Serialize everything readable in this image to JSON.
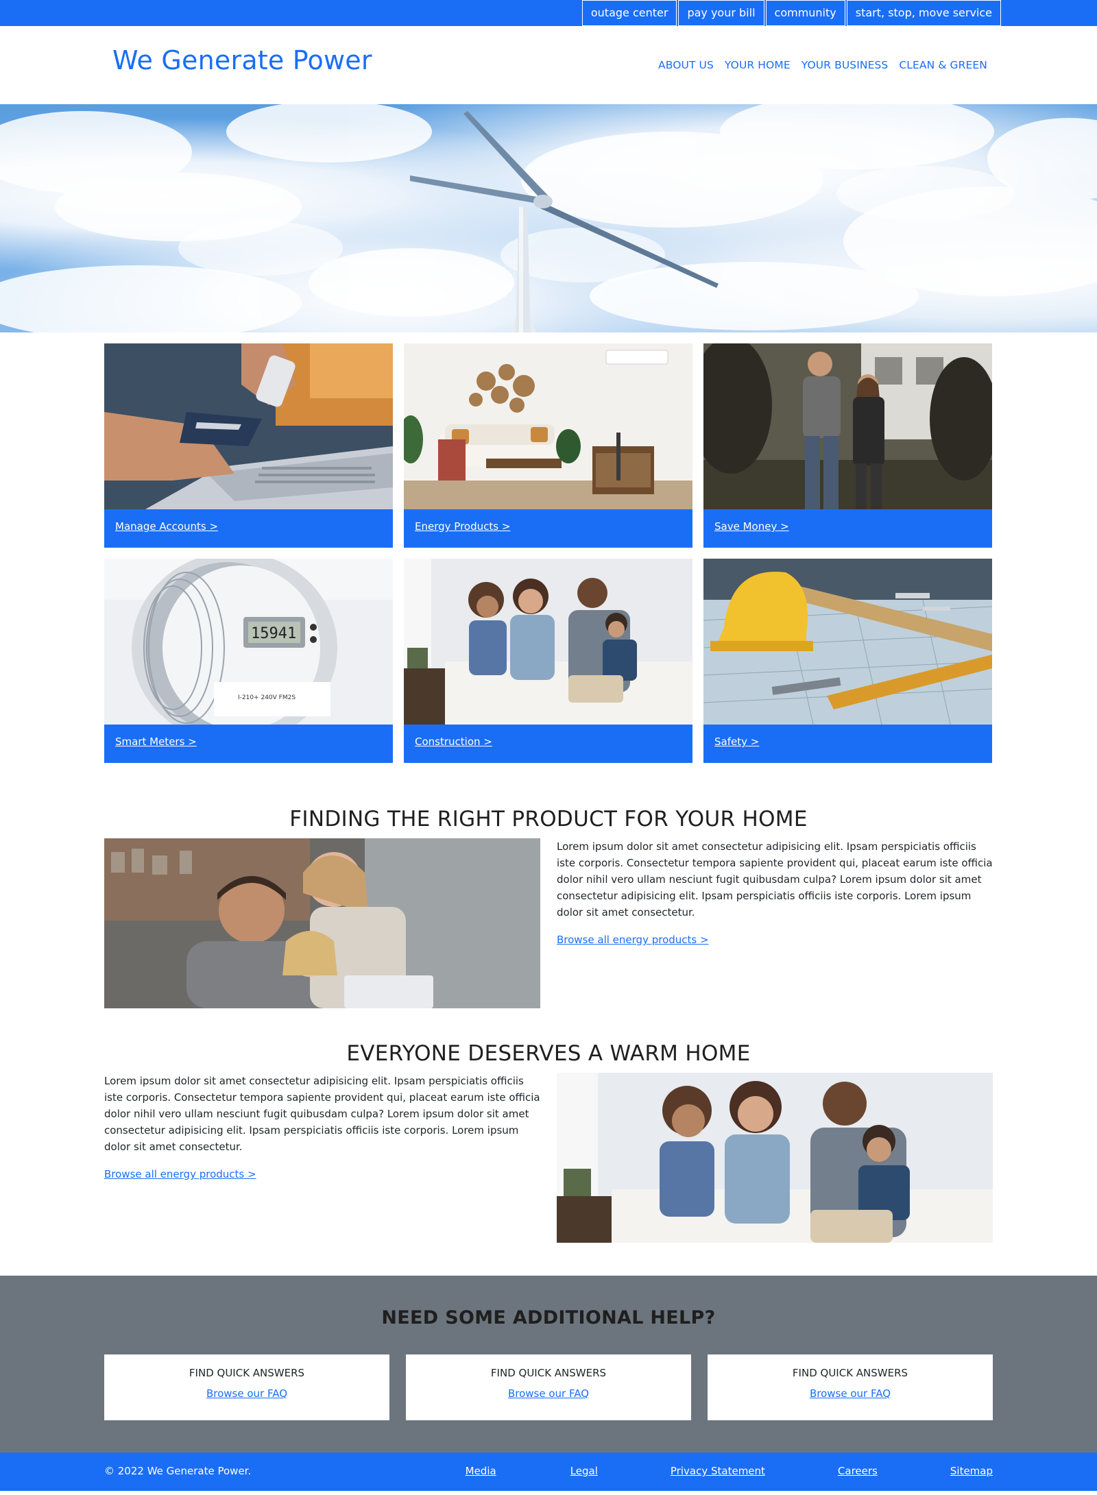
{
  "utility_nav": [
    {
      "label": "outage center"
    },
    {
      "label": "pay your bill"
    },
    {
      "label": "community"
    },
    {
      "label": "start, stop, move service"
    }
  ],
  "header": {
    "brand": "We Generate Power",
    "nav": [
      {
        "label": "ABOUT US"
      },
      {
        "label": "YOUR HOME"
      },
      {
        "label": "YOUR BUSINESS"
      },
      {
        "label": "CLEAN & GREEN"
      }
    ]
  },
  "tiles": [
    {
      "label": "Manage Accounts >",
      "image": "laptop-credit-card"
    },
    {
      "label": "Energy Products >",
      "image": "living-room"
    },
    {
      "label": "Save Money >",
      "image": "couple-outside-house"
    },
    {
      "label": "Smart Meters >",
      "image": "electric-meter"
    },
    {
      "label": "Construction >",
      "image": "family-on-couch"
    },
    {
      "label": "Safety >",
      "image": "hard-hat-blueprints"
    }
  ],
  "features": [
    {
      "title": "FINDING THE RIGHT PRODUCT FOR YOUR HOME",
      "text": "Lorem ipsum dolor sit amet consectetur adipisicing elit. Ipsam perspiciatis officiis iste corporis. Consectetur tempora sapiente provident qui, placeat earum iste officia dolor nihil vero ullam nesciunt fugit quibusdam culpa? Lorem ipsum dolor sit amet consectetur adipisicing elit. Ipsam perspiciatis officiis iste corporis. Lorem ipsum dolor sit amet consectetur.",
      "link": "Browse all energy products >"
    },
    {
      "title": "EVERYONE DESERVES A WARM HOME",
      "text": "Lorem ipsum dolor sit amet consectetur adipisicing elit. Ipsam perspiciatis officiis iste corporis. Consectetur tempora sapiente provident qui, placeat earum iste officia dolor nihil vero ullam nesciunt fugit quibusdam culpa? Lorem ipsum dolor sit amet consectetur adipisicing elit. Ipsam perspiciatis officiis iste corporis. Lorem ipsum dolor sit amet consectetur.",
      "link": "Browse all energy products >"
    }
  ],
  "help": {
    "title": "NEED SOME ADDITIONAL HELP?",
    "cards": [
      {
        "title": "FIND QUICK ANSWERS",
        "link": "Browse our FAQ"
      },
      {
        "title": "FIND QUICK ANSWERS",
        "link": "Browse our FAQ"
      },
      {
        "title": "FIND QUICK ANSWERS",
        "link": "Browse our FAQ"
      }
    ]
  },
  "footer": {
    "copyright": "© 2022 We Generate Power.",
    "links": [
      {
        "label": "Media"
      },
      {
        "label": "Legal"
      },
      {
        "label": "Privacy Statement"
      },
      {
        "label": "Careers"
      },
      {
        "label": "Sitemap"
      }
    ]
  },
  "colors": {
    "brand_blue": "#1a6ef5",
    "help_gray": "#6c757d",
    "text_dark": "#212529"
  }
}
